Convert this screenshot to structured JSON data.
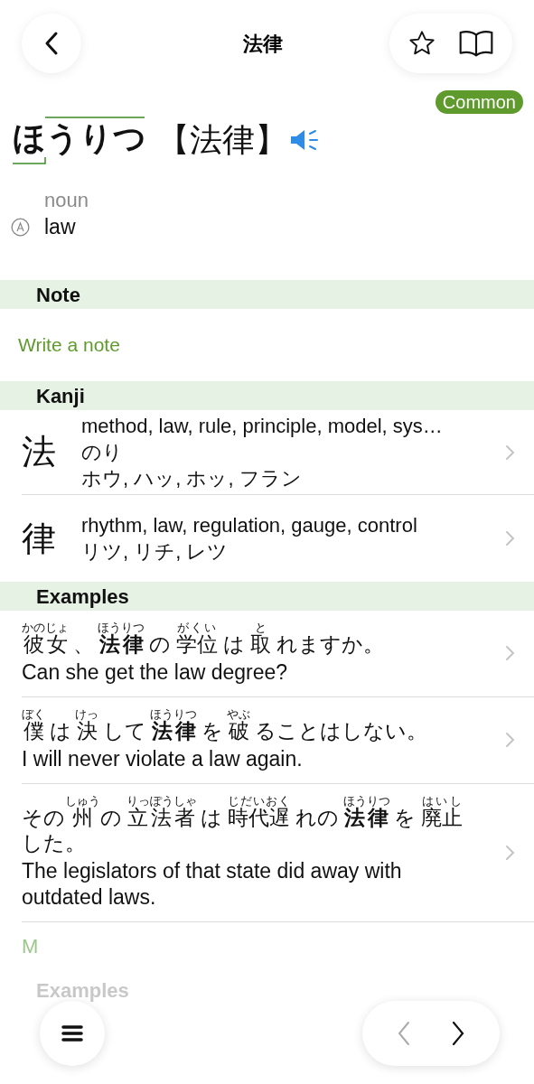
{
  "nav": {
    "title": "法律"
  },
  "entry": {
    "badge": "Common",
    "reading": "ほうりつ",
    "kanji": "【法律】",
    "pos": "noun",
    "meaning": "law"
  },
  "note": {
    "heading": "Note",
    "link": "Write a note"
  },
  "kanji": {
    "heading": "Kanji",
    "items": [
      {
        "char": "法",
        "meanings": "method, law, rule, principle, model, sys…",
        "kun": "のり",
        "on": "ホウ, ハッ, ホッ, フラン"
      },
      {
        "char": "律",
        "meanings": "rhythm, law, regulation, gauge, control",
        "on": "リツ, リチ, レツ"
      }
    ]
  },
  "examples": {
    "heading": "Examples",
    "items": [
      {
        "segments": [
          {
            "text": "彼女",
            "ruby": "かのじょ"
          },
          {
            "text": "、"
          },
          {
            "text": "法律",
            "ruby": "ほうりつ",
            "bold": true
          },
          {
            "text": "の"
          },
          {
            "text": "学位",
            "ruby": "がくい"
          },
          {
            "text": "は"
          },
          {
            "text": "取",
            "ruby": "と"
          },
          {
            "text": "れますか。"
          }
        ],
        "translation": "Can she get the law degree?"
      },
      {
        "segments": [
          {
            "text": "僕",
            "ruby": "ぼく"
          },
          {
            "text": "は"
          },
          {
            "text": "決",
            "ruby": "けっ"
          },
          {
            "text": "して"
          },
          {
            "text": "法律",
            "ruby": "ほうりつ",
            "bold": true
          },
          {
            "text": "を"
          },
          {
            "text": "破",
            "ruby": "やぶ"
          },
          {
            "text": "ることはしない。"
          }
        ],
        "translation": "I will never violate a law again."
      },
      {
        "segments": [
          {
            "text": "その"
          },
          {
            "text": "州",
            "ruby": "しゅう"
          },
          {
            "text": "の"
          },
          {
            "text": "立法者",
            "ruby": "りっぽうしゃ"
          },
          {
            "text": "は"
          },
          {
            "text": "時代遅",
            "ruby": "じだいおく"
          },
          {
            "text": "れの"
          },
          {
            "text": "法律",
            "ruby": "ほうりつ",
            "bold": true
          },
          {
            "text": "を"
          },
          {
            "text": "廃止",
            "ruby": "はいし"
          },
          {
            "text": "した。"
          }
        ],
        "translation": "The legislators of that state did away with outdated laws."
      }
    ]
  },
  "more": {
    "link": "M",
    "heading": "Examples"
  }
}
